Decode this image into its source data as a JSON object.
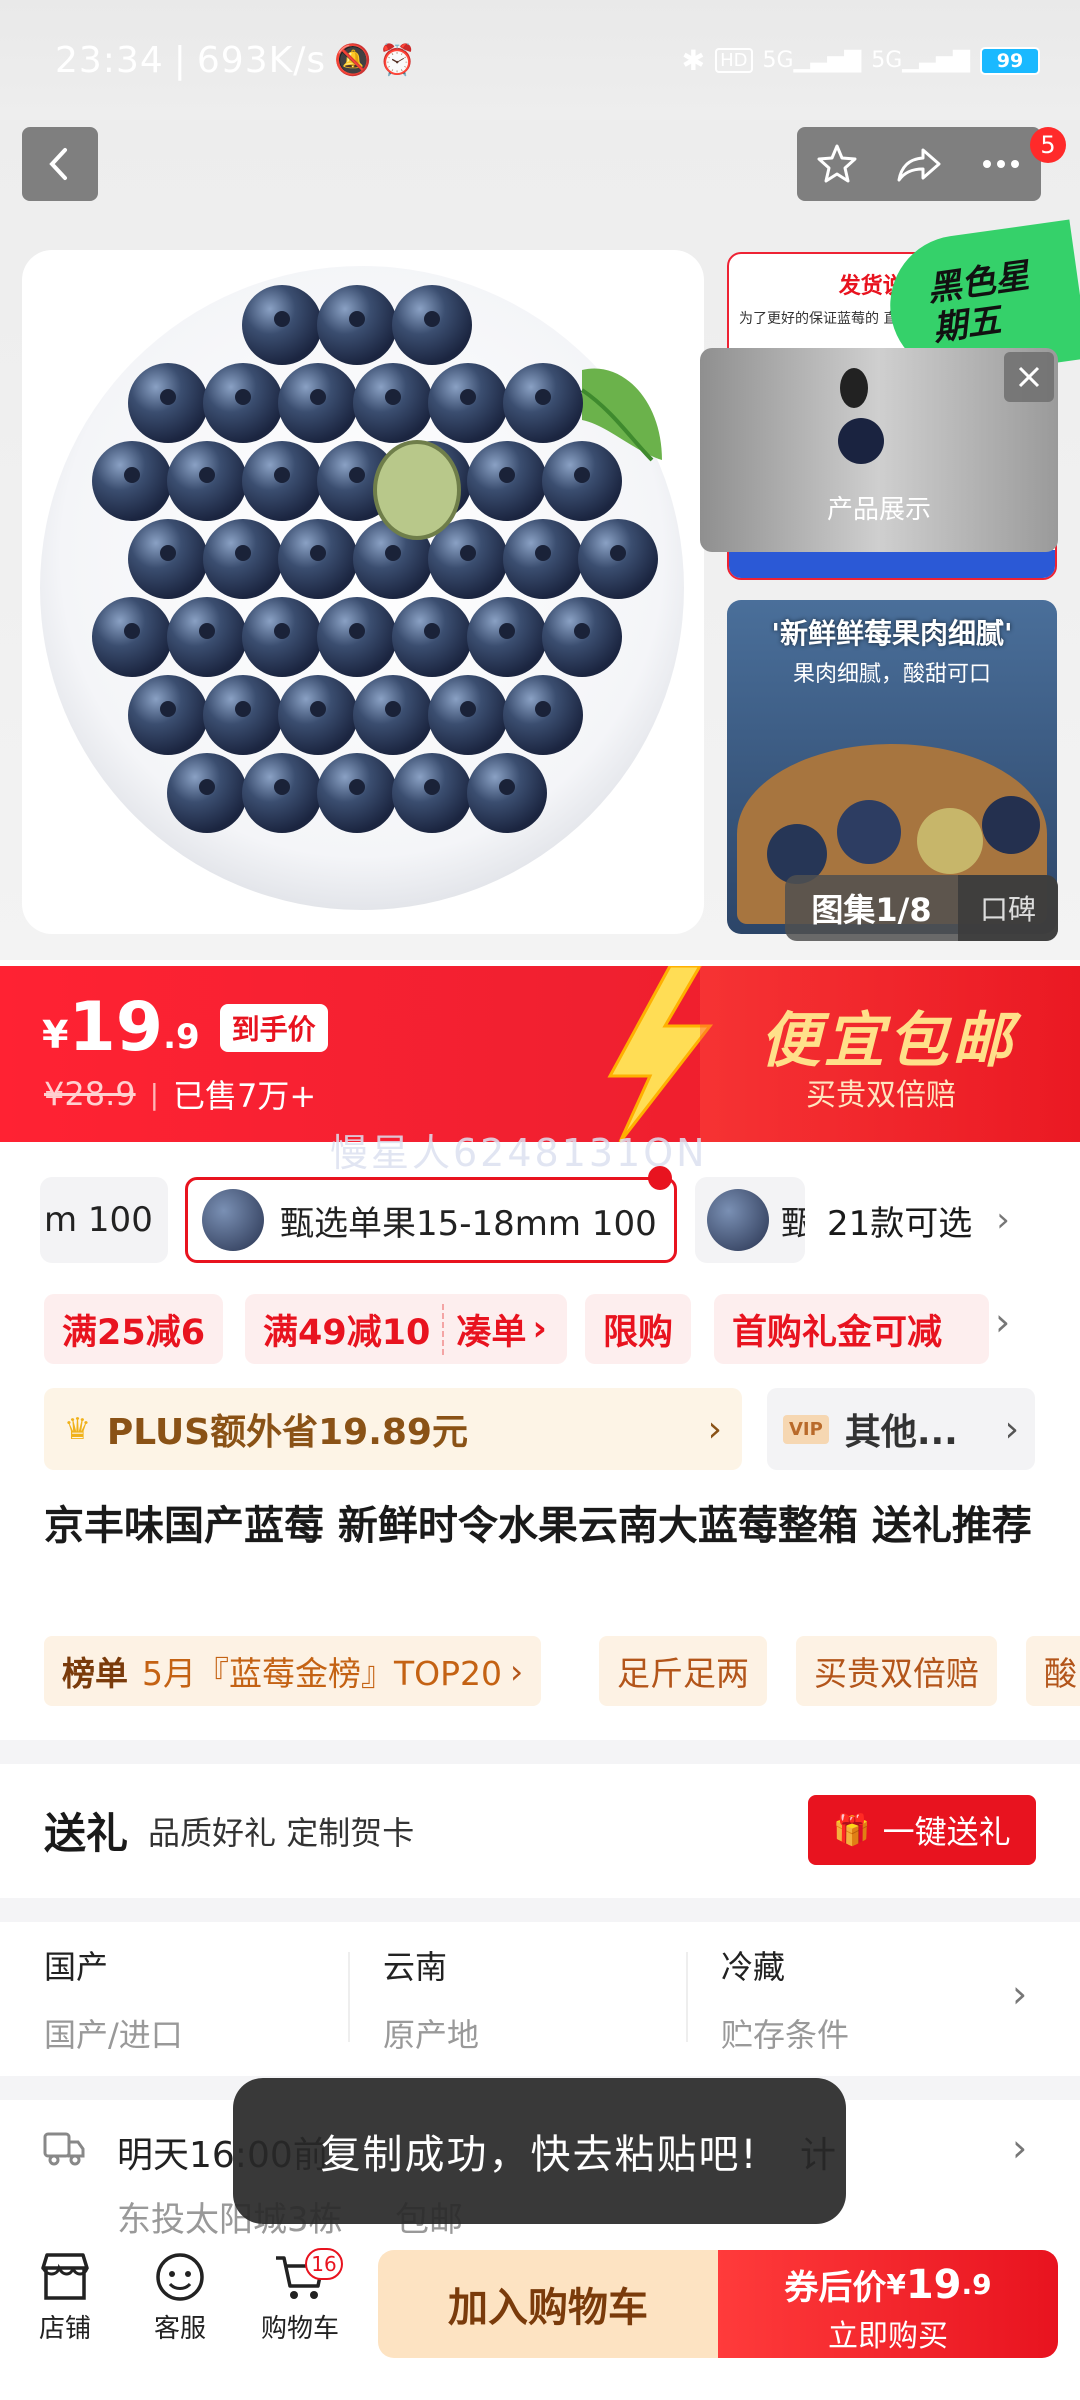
{
  "status_bar": {
    "time": "23:34",
    "speed": "693K/s",
    "network": "5G",
    "battery": "99"
  },
  "nav": {
    "cart_badge": "5"
  },
  "gallery": {
    "thumb1_title": "发货说明+",
    "thumb1_text": "为了更好的保证蓝莓的 直发京东快递，送货上",
    "sticker": "黑色星期五",
    "video_label": "产品展示",
    "thumb2_title": "'新鲜鲜莓果肉细腻'",
    "thumb2_sub": "果肉细腻，酸甜可口",
    "gallery_count": "图集1/8",
    "reviews_tab": "口碑"
  },
  "price": {
    "currency": "¥",
    "main": "19",
    "decimal": ".9",
    "badge": "到手价",
    "original": "¥28.9",
    "sold": "已售7万+",
    "promo_title": "便宜包邮",
    "promo_sub": "买贵双倍赔",
    "watermark": "慢星人6248131ON"
  },
  "sku": {
    "opt0": "m 100",
    "opt1": "甄选单果15-18mm 100",
    "opt2": "甄",
    "more": "21款可选"
  },
  "coupons": [
    "满25减6",
    "满49减10",
    "凑单",
    "限购",
    "首购礼金可减"
  ],
  "plus": {
    "text": "PLUS额外省19.89元",
    "other": "其他..."
  },
  "title": "京丰味国产蓝莓 新鲜时令水果云南大蓝莓整箱 送礼推荐",
  "tags": {
    "rank_label": "榜单",
    "rank_text": "5月『蓝莓金榜』TOP20",
    "t1": "足斤足两",
    "t2": "买贵双倍赔",
    "t3": "酸"
  },
  "gift": {
    "title": "送礼",
    "desc": "品质好礼 定制贺卡",
    "button": "一键送礼"
  },
  "specs": [
    {
      "value": "国产",
      "label": "国产/进口"
    },
    {
      "value": "云南",
      "label": "原产地"
    },
    {
      "value": "冷藏",
      "label": "贮存条件"
    }
  ],
  "delivery": {
    "line1": "明天16:00前",
    "line1b": "计",
    "line2": "东投太阳城3栋",
    "line2b": "包邮"
  },
  "toast": "复制成功，快去粘贴吧!",
  "tabbar": {
    "shop": "店铺",
    "service": "客服",
    "cart": "购物车",
    "cart_badge": "16",
    "add_cart": "加入购物车",
    "buy_price_prefix": "券后价",
    "buy_currency": "¥",
    "buy_price": "19",
    "buy_decimal": ".9",
    "buy_now": "立即购买"
  },
  "colors": {
    "accent": "#e8131f",
    "gold": "#f5d36b",
    "tag_text": "#b3551a"
  }
}
